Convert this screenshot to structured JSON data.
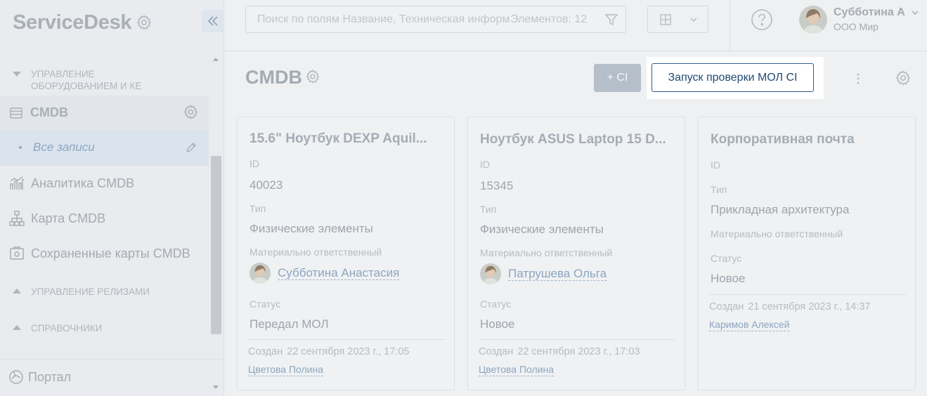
{
  "app": {
    "brand": "ServiceDesk"
  },
  "sidebar": {
    "section_equipment": "Управление оборудованием и КЕ",
    "cmdb_label": "CMDB",
    "all_records_label": "Все записи",
    "items": [
      {
        "label": "Аналитика CMDB",
        "icon": "analytics-icon"
      },
      {
        "label": "Карта CMDB",
        "icon": "hierarchy-icon"
      },
      {
        "label": "Сохраненные карты CMDB",
        "icon": "saved-map-icon"
      }
    ],
    "section_releases": "Управление релизами",
    "section_reference": "Справочники",
    "portal_label": "Портал"
  },
  "topbar": {
    "search_placeholder": "Поиск по полям Название, Техническая информация",
    "elements_count": "Элементов: 12",
    "user_name": "Субботина А",
    "user_org": "ООО Мир"
  },
  "main": {
    "title": "CMDB",
    "add_ci_label": "+ CI",
    "run_check_label": "Запуск проверки МОЛ CI"
  },
  "labels": {
    "id": "ID",
    "type": "Тип",
    "mol": "Материально ответственный",
    "status": "Статус",
    "created": "Создан"
  },
  "cards": [
    {
      "title": "15.6\" Ноутбук DEXP Aquil...",
      "id": "40023",
      "type": "Физические элементы",
      "mol": "Субботина Анастасия",
      "status": "Передал МОЛ",
      "created": "22 сентября 2023 г., 17:05",
      "author": "Цветова Полина"
    },
    {
      "title": "Ноутбук ASUS Laptop 15 D...",
      "id": "15345",
      "type": "Физические элементы",
      "mol": "Патрушева Ольга",
      "status": "Новое",
      "created": "22 сентября 2023 г., 17:03",
      "author": "Цветова Полина"
    },
    {
      "title": "Корпоративная почта",
      "id": "",
      "type": "Прикладная архитектура",
      "mol": "",
      "status": "Новое",
      "created": "21 сентября 2023 г., 14:37",
      "author": "Каримов Алексей"
    }
  ],
  "colors": {
    "accent": "#2f5d8c",
    "link": "#8ea5c0"
  }
}
